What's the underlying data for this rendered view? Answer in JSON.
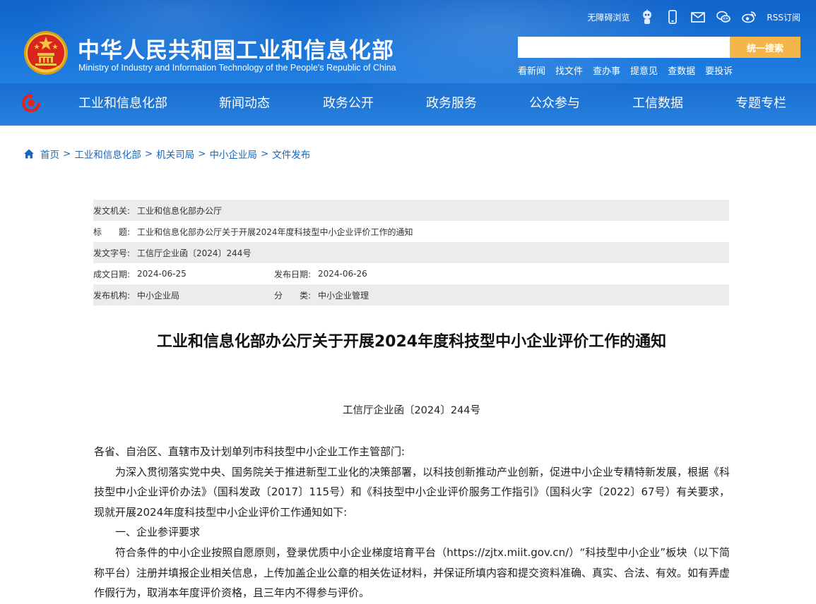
{
  "header": {
    "site_title": "中华人民共和国工业和信息化部",
    "site_subtitle": "Ministry of Industry and Information Technology of the People's Republic of China",
    "accessibility_label": "无障碍浏览",
    "rss_label": "RSS订阅",
    "search_placeholder": "",
    "search_button": "统一搜索",
    "quick_links": [
      "看新闻",
      "找文件",
      "查办事",
      "提意见",
      "查数据",
      "要投诉"
    ],
    "brand_color": "#1a77dc",
    "search_button_color": "#f4b54b"
  },
  "nav": {
    "items": [
      "工业和信息化部",
      "新闻动态",
      "政务公开",
      "政务服务",
      "公众参与",
      "工信数据",
      "专题专栏"
    ]
  },
  "breadcrumb": [
    "首页",
    "工业和信息化部",
    "机关司局",
    "中小企业局",
    "文件发布"
  ],
  "info": {
    "issuer_label": "发文机关:",
    "issuer": "工业和信息化部办公厅",
    "title_label": "标　　题:",
    "title": "工业和信息化部办公厅关于开展2024年度科技型中小企业评价工作的通知",
    "docnum_label": "发文字号:",
    "docnum": "工信厅企业函〔2024〕244号",
    "written_label": "成文日期:",
    "written": "2024-06-25",
    "published_label": "发布日期:",
    "published": "2024-06-26",
    "agency_label": "发布机构:",
    "agency": "中小企业局",
    "category_label": "分　　类:",
    "category": "中小企业管理"
  },
  "article": {
    "title": "工业和信息化部办公厅关于开展2024年度科技型中小企业评价工作的通知",
    "doc_number": "工信厅企业函〔2024〕244号",
    "salutation": "各省、自治区、直辖市及计划单列市科技型中小企业工作主管部门:",
    "para1": "为深入贯彻落实党中央、国务院关于推进新型工业化的决策部署，以科技创新推动产业创新，促进中小企业专精特新发展，根据《科技型中小企业评价办法》（国科发政〔2017〕115号）和《科技型中小企业评价服务工作指引》（国科火字〔2022〕67号）有关要求，现就开展2024年度科技型中小企业评价工作通知如下:",
    "section1": "一、企业参评要求",
    "para2": "符合条件的中小企业按照自愿原则，登录优质中小企业梯度培育平台（https://zjtx.miit.gov.cn/）“科技型中小企业”板块（以下简称平台）注册并填报企业相关信息，上传加盖企业公章的相关佐证材料，并保证所填内容和提交资料准确、真实、合法、有效。如有弄虚作假行为，取消本年度评价资格，且三年内不得参与评价。"
  }
}
